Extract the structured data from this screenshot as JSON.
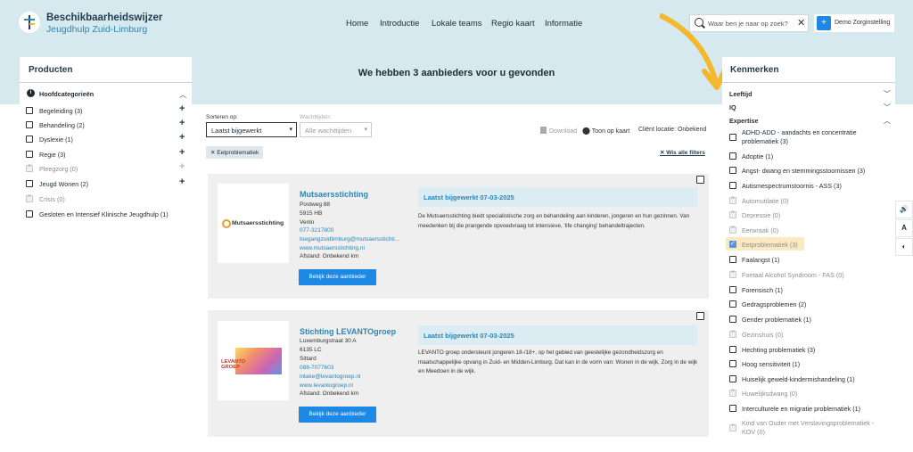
{
  "header": {
    "brand_title": "Beschikbaarheidswijzer",
    "brand_subtitle": "Jeugdhulp Zuid-Limburg",
    "nav": [
      "Home",
      "Introductie",
      "Lokale teams",
      "Regio kaart",
      "Informatie"
    ],
    "search_placeholder": "Waar ben je naar op zoek?",
    "user_label": "Demo Zorginstelling"
  },
  "left": {
    "title": "Producten",
    "section": "Hoofdcategorieën",
    "items": [
      {
        "label": "Begeleiding (3)",
        "disabled": false
      },
      {
        "label": "Behandeling (2)",
        "disabled": false
      },
      {
        "label": "Dyslexie (1)",
        "disabled": false
      },
      {
        "label": "Regie (3)",
        "disabled": false
      },
      {
        "label": "Pleegzorg (0)",
        "disabled": true
      },
      {
        "label": "Jeugd Wonen (2)",
        "disabled": false
      },
      {
        "label": "Crisis (0)",
        "disabled": true
      },
      {
        "label": "Gesloten en Intensief Klinische Jeugdhulp (1)",
        "disabled": false
      }
    ]
  },
  "main": {
    "results_title": "We hebben 3 aanbieders voor u gevonden",
    "sort_label": "Sorteren op:",
    "sort_value": "Laatst bijgewerkt",
    "wait_label": "Wachttijden:",
    "wait_value": "Alle wachttijden",
    "download": "Download",
    "map": "Toon op kaart",
    "client_location": "Cliënt locatie: Onbekend",
    "chip": "Eetproblematiek",
    "clear_filters": "Wis alle filters",
    "cards": [
      {
        "name": "Mutsaersstichting",
        "logo_text": "Mutsaersstichting",
        "address": "Postweg 88",
        "postcode": "5915 HB",
        "city": "Venlo",
        "phone": "077-3217800",
        "email": "toegangzuidlimburg@mutsaersstichti...",
        "website": "www.mutsaersstichting.nl",
        "distance": "Afstand: Onbekend km",
        "button": "Bekijk deze aanbieder",
        "updated": "Laatst bijgewerkt 07-03-2025",
        "description": "De Mutsaersstichting biedt specialistische zorg en behandeling aan kinderen, jongeren en hun gezinnen. Van meedenken bij die prangende opvoedvraag tot intensieve, 'life changing' behandeltrajecten."
      },
      {
        "name": "Stichting LEVANTOgroep",
        "logo_text": "LEVANTO GROEP",
        "address": "Luxemburgstraat 30 A",
        "postcode": "6135 LC",
        "city": "Sittard",
        "phone": "088-7077603",
        "email": "intake@levantogroep.nl",
        "website": "www.levantogroep.nl",
        "distance": "Afstand: Onbekend km",
        "button": "Bekijk deze aanbieder",
        "updated": "Laatst bijgewerkt 07-03-2025",
        "description": "LEVANTO groep ondersteunt jongeren 18-/18+, op het gebied van geestelijke gezondheidszorg en maatschappelijke opvang in Zuid- en Midden-Limburg. Dat kan in de vorm van: Wonen in de wijk, Zorg in de wijk en Meedoen in de wijk."
      }
    ]
  },
  "right": {
    "title": "Kenmerken",
    "sections": [
      "Leeftijd",
      "IQ",
      "Expertise"
    ],
    "items": [
      {
        "label": "ADHD-ADD - aandachts en concentratie",
        "label2": "problematiek (3)",
        "state": "normal"
      },
      {
        "label": "Adoptie (1)",
        "state": "normal"
      },
      {
        "label": "Angst- dwang en stemmingsstoornissen (3)",
        "state": "normal"
      },
      {
        "label": "Autismespectrumstoornis - ASS (3)",
        "state": "normal"
      },
      {
        "label": "Automutilatie (0)",
        "state": "disabled"
      },
      {
        "label": "Depressie (0)",
        "state": "disabled"
      },
      {
        "label": "Eerwraak (0)",
        "state": "disabled"
      },
      {
        "label": "Eetproblematiek (3)",
        "state": "checked"
      },
      {
        "label": "Faalangst (1)",
        "state": "normal"
      },
      {
        "label": "Foetaal Alcohol Syndroom - FAS (0)",
        "state": "disabled"
      },
      {
        "label": "Forensisch (1)",
        "state": "normal"
      },
      {
        "label": "Gedragsproblemen (2)",
        "state": "normal"
      },
      {
        "label": "Gender problematiek (1)",
        "state": "normal"
      },
      {
        "label": "Gezinshuis (0)",
        "state": "disabled"
      },
      {
        "label": "Hechting problematiek (3)",
        "state": "normal"
      },
      {
        "label": "Hoog sensitiviteit (1)",
        "state": "normal"
      },
      {
        "label": "Huiselijk geweld-kindermishandeling (1)",
        "state": "normal"
      },
      {
        "label": "Huwelijksdwang (0)",
        "state": "disabled"
      },
      {
        "label": "Interculturele en migratie problematiek (1)",
        "state": "normal"
      },
      {
        "label": "Kind van Ouder met Verslavingsproblematiek -",
        "label2": "KOV (0)",
        "state": "disabled"
      }
    ]
  },
  "a11y": {
    "speak": "🔊",
    "font": "A",
    "contrast": "◐"
  },
  "colors": {
    "accent": "#1e88e5",
    "band": "#d6e9ef",
    "arrow": "#f4b82e",
    "highlight": "#fbe9c4"
  }
}
